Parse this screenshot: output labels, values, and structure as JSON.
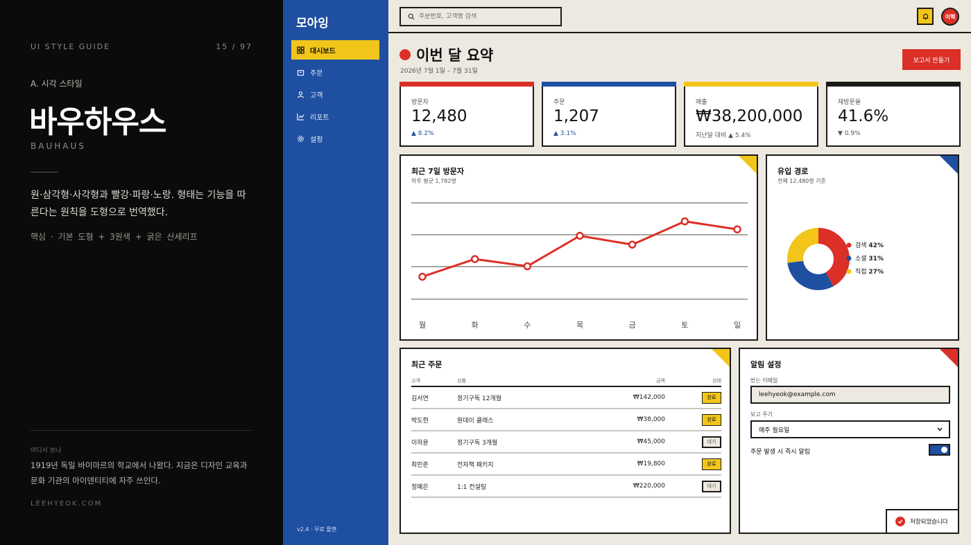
{
  "guide": {
    "eyebrow": "UI STYLE GUIDE",
    "pager": "15 / 97",
    "section": "A. 시각 스타일",
    "title": "바우하우스",
    "subtitle": "BAUHAUS",
    "description": "원·삼각형·사각형과 빨강·파랑·노랑. 형태는 기능을 따른다는 원칙을 도형으로 번역했다.",
    "core": "핵심  ·  기본 도형  +  3원색  +  굵은 산세리프",
    "where_label": "어디서 보나",
    "where_text": "1919년 독일 바이마르의 학교에서 나왔다. 지금은 디자인 교육과 문화 기관의 아이덴티티에 자주 쓰인다.",
    "site": "LEEHYEOK.COM"
  },
  "sidebar": {
    "brand": "모아잉",
    "items": [
      {
        "label": "대시보드",
        "icon": "grid-icon"
      },
      {
        "label": "주문",
        "icon": "bag-icon"
      },
      {
        "label": "고객",
        "icon": "user-icon"
      },
      {
        "label": "리포트",
        "icon": "chart-icon"
      },
      {
        "label": "설정",
        "icon": "gear-icon"
      }
    ],
    "version": "v2.4 · 무료 플랜"
  },
  "topbar": {
    "search_placeholder": "주문번호, 고객명 검색",
    "avatar": "이혁"
  },
  "header": {
    "title": "이번 달 요약",
    "date_range": "2026년 7월 1일 – 7월 31일",
    "report_button": "보고서 만들기"
  },
  "kpis": [
    {
      "label": "방문자",
      "value": "12,480",
      "delta": "▲ 8.2%",
      "color": "#db2f27"
    },
    {
      "label": "주문",
      "value": "1,207",
      "delta": "▲ 3.1%",
      "color": "#1f4fa0"
    },
    {
      "label": "매출",
      "value": "₩38,200,000",
      "delta": "지난달 대비 ▲ 5.4%",
      "color": "#f2c51b"
    },
    {
      "label": "재방문율",
      "value": "41.6%",
      "delta": "▼ 0.9%",
      "color": "#1a1a1a"
    }
  ],
  "visitors_panel": {
    "title": "최근 7일 방문자",
    "subtitle": "하루 평균 1,782명"
  },
  "source_panel": {
    "title": "유입 경로",
    "subtitle": "전체 12,480명 기준"
  },
  "chart_data": [
    {
      "type": "line",
      "title": "최근 7일 방문자",
      "categories": [
        "월",
        "화",
        "수",
        "목",
        "금",
        "토",
        "일"
      ],
      "series": [
        {
          "values": [
            1480,
            1700,
            1610,
            1990,
            1880,
            2170,
            2070
          ],
          "color": "#db2f27"
        }
      ],
      "ylim": [
        1200,
        2400
      ],
      "grid": true
    },
    {
      "type": "pie",
      "title": "유입 경로",
      "donut": true,
      "slices": [
        {
          "label": "검색",
          "value": 42,
          "display": "42%",
          "color": "#db2f27"
        },
        {
          "label": "소셜",
          "value": 31,
          "display": "31%",
          "color": "#1f4fa0"
        },
        {
          "label": "직접",
          "value": 27,
          "display": "27%",
          "color": "#f2c51b"
        }
      ]
    }
  ],
  "orders": {
    "title": "최근 주문",
    "columns": [
      "고객",
      "상품",
      "금액",
      "상태"
    ],
    "rows": [
      {
        "customer": "김서연",
        "product": "정기구독 12개월",
        "amount": "₩142,000",
        "status": "완료",
        "state": "done"
      },
      {
        "customer": "박도현",
        "product": "원데이 클래스",
        "amount": "₩38,000",
        "status": "완료",
        "state": "done"
      },
      {
        "customer": "이하윤",
        "product": "정기구독 3개월",
        "amount": "₩45,000",
        "status": "대기",
        "state": "wait"
      },
      {
        "customer": "최민준",
        "product": "전자책 패키지",
        "amount": "₩19,800",
        "status": "완료",
        "state": "done"
      },
      {
        "customer": "정예은",
        "product": "1:1 컨설팅",
        "amount": "₩220,000",
        "status": "대기",
        "state": "wait"
      }
    ]
  },
  "alerts": {
    "title": "알림 설정",
    "email_label": "받는 이메일",
    "email_value": "leehyeok@example.com",
    "cycle_label": "보고 주기",
    "cycle_value": "매주 월요일",
    "toggle_label": "주문 발생 시 즉시 알림",
    "toggle_on": true
  },
  "toast": "저장되었습니다",
  "colors": {
    "red": "#db2f27",
    "blue": "#1f4fa0",
    "yellow": "#f2c51b",
    "black": "#1a1a1a"
  }
}
